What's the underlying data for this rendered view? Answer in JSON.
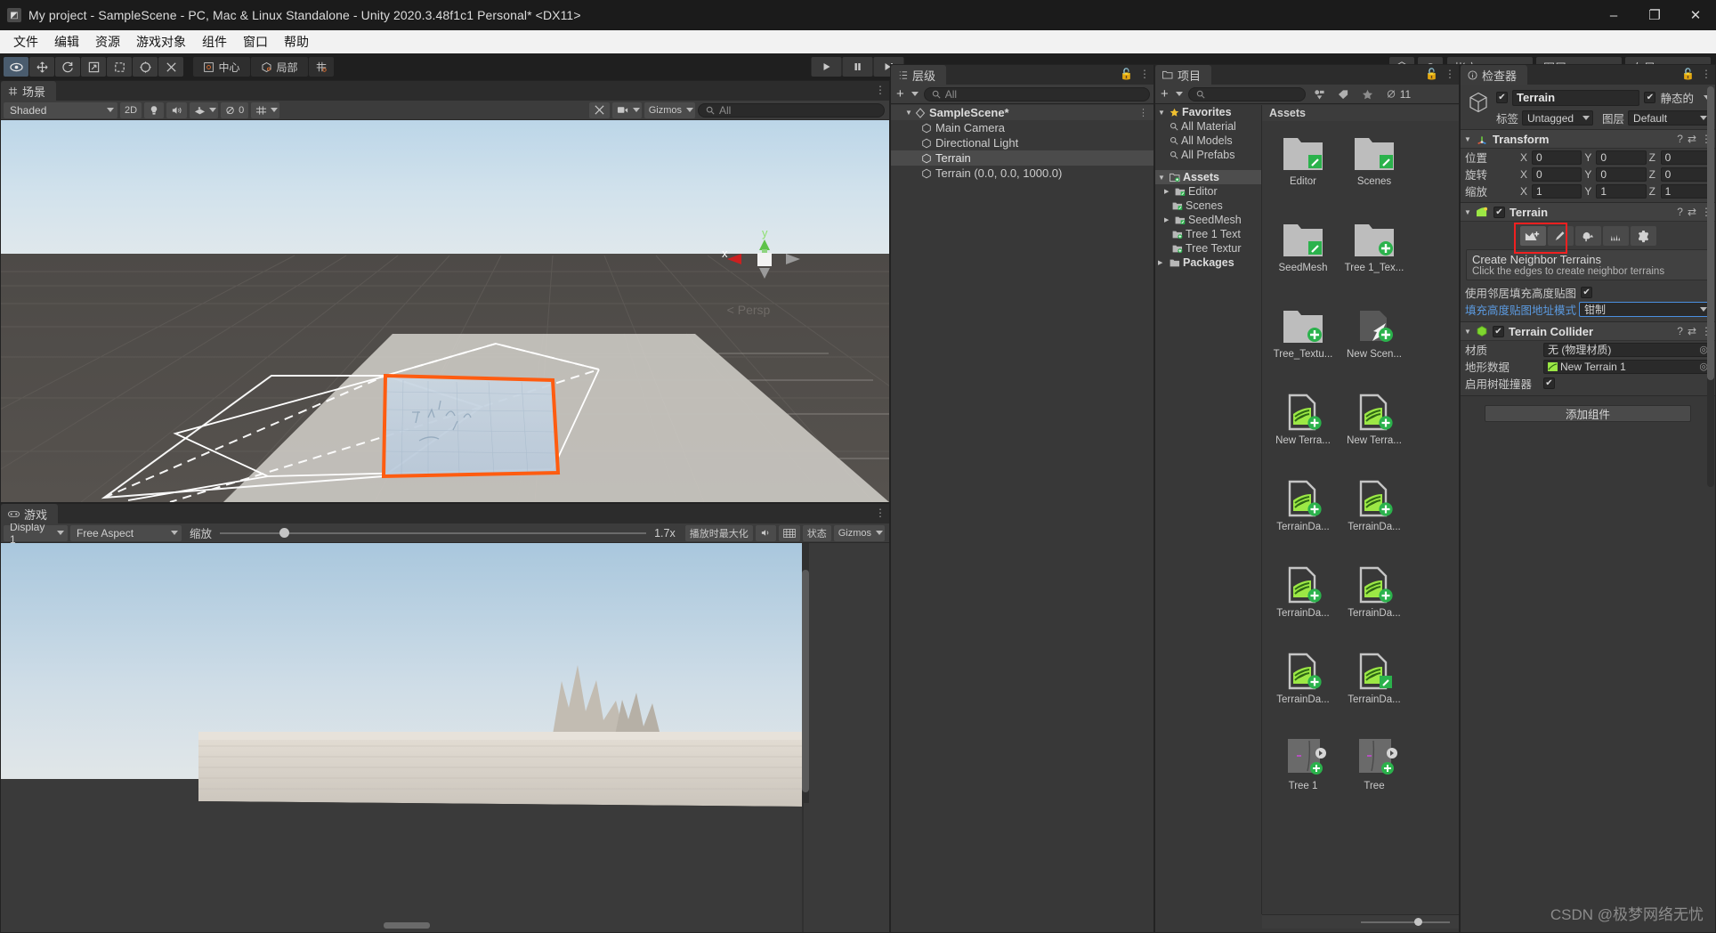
{
  "window": {
    "title": "My project - SampleScene - PC, Mac & Linux Standalone - Unity 2020.3.48f1c1 Personal* <DX11>",
    "minimize": "–",
    "maximize": "❐",
    "close": "✕"
  },
  "menu": {
    "items": [
      "文件",
      "编辑",
      "资源",
      "游戏对象",
      "组件",
      "窗口",
      "帮助"
    ]
  },
  "toolbar": {
    "tools": [
      {
        "name": "hand-tool-icon",
        "glyph": "◉",
        "active": true
      },
      {
        "name": "move-tool-icon",
        "glyph": "✥",
        "active": false
      },
      {
        "name": "rotate-tool-icon",
        "glyph": "↻",
        "active": false
      },
      {
        "name": "scale-tool-icon",
        "glyph": "↗",
        "active": false
      },
      {
        "name": "rect-tool-icon",
        "glyph": "⬚",
        "active": false
      },
      {
        "name": "transform-tool-icon",
        "glyph": "❁",
        "active": false
      },
      {
        "name": "custom-tool-icon",
        "glyph": "⚒",
        "active": false
      }
    ],
    "pivot_label": "中心",
    "space_label": "局部",
    "grid_label": "",
    "play": "▶",
    "pause": "▐▐",
    "step": "▶|",
    "cloud_label": "",
    "account_label": "帐户",
    "layers_label": "图层",
    "layout_label": "布局"
  },
  "scene": {
    "tab_label": "场景",
    "shading_mode": "Shaded",
    "mode_2d": "2D",
    "gizmos_label": "Gizmos",
    "search_placeholder": "All",
    "audio_count": "0",
    "persp_label": "Persp",
    "axis_x": "x",
    "axis_y": "y"
  },
  "game": {
    "tab_label": "游戏",
    "display": "Display 1",
    "aspect": "Free Aspect",
    "scale_label": "缩放",
    "scale_value": "1.7x",
    "maximize_on_play": "播放时最大化",
    "stats_label": "状态",
    "gizmos_label": "Gizmos"
  },
  "hierarchy": {
    "tab_label": "层级",
    "search_placeholder": "All",
    "add_label": "+",
    "rows": [
      {
        "label": "SampleScene*",
        "depth": 0,
        "icon": "scene-icon",
        "bold": true,
        "arrow": "▼",
        "selected": false
      },
      {
        "label": "Main Camera",
        "depth": 1,
        "icon": "gameobject-icon",
        "bold": false,
        "arrow": "",
        "selected": false
      },
      {
        "label": "Directional Light",
        "depth": 1,
        "icon": "gameobject-icon",
        "bold": false,
        "arrow": "",
        "selected": false
      },
      {
        "label": "Terrain",
        "depth": 1,
        "icon": "gameobject-icon",
        "bold": false,
        "arrow": "",
        "selected": true
      },
      {
        "label": "Terrain (0.0, 0.0, 1000.0)",
        "depth": 1,
        "icon": "gameobject-icon",
        "bold": false,
        "arrow": "",
        "selected": false
      }
    ]
  },
  "project": {
    "tab_label": "项目",
    "search_placeholder": "",
    "hidden_count": "11",
    "assets_header": "Assets",
    "tree": [
      {
        "label": "Favorites",
        "depth": 0,
        "arrow": "▼",
        "icon": "star-icon",
        "bold": true
      },
      {
        "label": "All Material",
        "depth": 1,
        "arrow": "",
        "icon": "search-icon",
        "bold": false
      },
      {
        "label": "All Models",
        "depth": 1,
        "arrow": "",
        "icon": "search-icon",
        "bold": false
      },
      {
        "label": "All Prefabs",
        "depth": 1,
        "arrow": "",
        "icon": "search-icon",
        "bold": false
      },
      {
        "label": "",
        "depth": 0,
        "arrow": "",
        "icon": "spacer",
        "bold": false
      },
      {
        "label": "Assets",
        "depth": 0,
        "arrow": "▼",
        "icon": "folder-green-icon",
        "bold": true,
        "selected": true
      },
      {
        "label": "Editor",
        "depth": 1,
        "arrow": "▶",
        "icon": "folder-green-icon",
        "bold": false
      },
      {
        "label": "Scenes",
        "depth": 1,
        "arrow": "",
        "icon": "folder-green-icon",
        "bold": false
      },
      {
        "label": "SeedMesh",
        "depth": 1,
        "arrow": "▶",
        "icon": "folder-green-icon",
        "bold": false
      },
      {
        "label": "Tree 1 Text",
        "depth": 1,
        "arrow": "",
        "icon": "folder-add-icon",
        "bold": false
      },
      {
        "label": "Tree Textur",
        "depth": 1,
        "arrow": "",
        "icon": "folder-add-icon",
        "bold": false
      },
      {
        "label": "Packages",
        "depth": 0,
        "arrow": "▶",
        "icon": "folder-plain-icon",
        "bold": true
      }
    ],
    "assets": [
      {
        "label": "Editor",
        "kind": "folder",
        "badge": "edit"
      },
      {
        "label": "Scenes",
        "kind": "folder",
        "badge": "edit"
      },
      {
        "label": "SeedMesh",
        "kind": "folder",
        "badge": "edit"
      },
      {
        "label": "Tree 1_Tex...",
        "kind": "folder",
        "badge": "add"
      },
      {
        "label": "Tree_Textu...",
        "kind": "folder",
        "badge": "add"
      },
      {
        "label": "New Scen...",
        "kind": "scene",
        "badge": "add"
      },
      {
        "label": "New Terra...",
        "kind": "terrain",
        "badge": "add"
      },
      {
        "label": "New Terra...",
        "kind": "terrain",
        "badge": "add"
      },
      {
        "label": "TerrainDa...",
        "kind": "terrain",
        "badge": "add"
      },
      {
        "label": "TerrainDa...",
        "kind": "terrain",
        "badge": "add"
      },
      {
        "label": "TerrainDa...",
        "kind": "terrain",
        "badge": "add"
      },
      {
        "label": "TerrainDa...",
        "kind": "terrain",
        "badge": "add"
      },
      {
        "label": "TerrainDa...",
        "kind": "terrain",
        "badge": "add"
      },
      {
        "label": "TerrainDa...",
        "kind": "terrain",
        "badge": "edit"
      },
      {
        "label": "Tree 1",
        "kind": "preview",
        "badge": "add"
      },
      {
        "label": "Tree",
        "kind": "preview",
        "badge": "add"
      }
    ]
  },
  "inspector": {
    "tab_label": "检查器",
    "object_name": "Terrain",
    "static_label": "静态的",
    "tag_label": "标签",
    "tag_value": "Untagged",
    "layer_label": "图层",
    "layer_value": "Default",
    "transform": {
      "title": "Transform",
      "position_label": "位置",
      "rotation_label": "旋转",
      "scale_label": "缩放",
      "position": [
        "0",
        "0",
        "0"
      ],
      "rotation": [
        "0",
        "0",
        "0"
      ],
      "scale": [
        "1",
        "1",
        "1"
      ],
      "axes": [
        "X",
        "Y",
        "Z"
      ]
    },
    "terrain": {
      "title": "Terrain",
      "tools": [
        {
          "name": "create-neighbor-terrains-tool",
          "glyph": "⛰",
          "active": true
        },
        {
          "name": "paint-terrain-tool",
          "glyph": "✒",
          "active": false
        },
        {
          "name": "paint-trees-tool",
          "glyph": "ἳ2",
          "active": false
        },
        {
          "name": "paint-details-tool",
          "glyph": "⚘",
          "active": false
        },
        {
          "name": "terrain-settings-tool",
          "glyph": "⚙",
          "active": false
        }
      ],
      "help_title": "Create Neighbor Terrains",
      "help_body": "Click the edges to create neighbor terrains",
      "fill_heightmap_label": "使用邻居填充高度贴图",
      "fill_heightmap_checked": true,
      "address_mode_label": "填充高度贴图地址模式",
      "address_mode_value": "钳制"
    },
    "terrain_collider": {
      "title": "Terrain Collider",
      "material_label": "材质",
      "material_value": "无 (物理材质)",
      "terrain_data_label": "地形数据",
      "terrain_data_value": "New Terrain 1",
      "tree_colliders_label": "启用树碰撞器",
      "tree_colliders_checked": true
    },
    "add_component_label": "添加组件"
  },
  "watermark": {
    "text": "CSDN @极梦网络无忧"
  },
  "colors": {
    "accent_blue": "#4a8fe0",
    "selection_orange": "#ff5c10",
    "unity_green": "#1ba94c",
    "panel_bg": "#383838",
    "header_bg": "#3c3c3c",
    "highlight_red": "#f02020"
  }
}
